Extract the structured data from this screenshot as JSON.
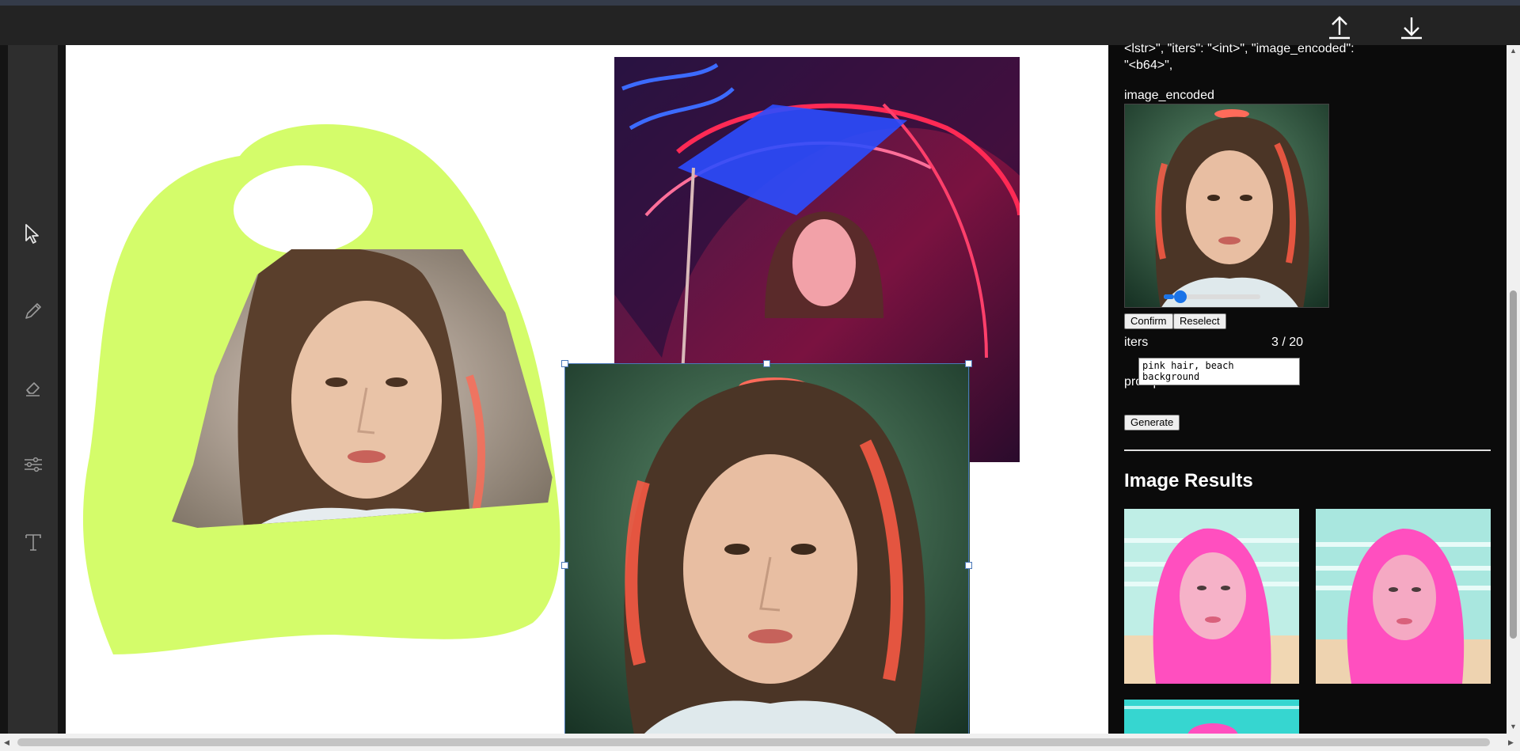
{
  "topbar": {
    "upload_icon": "upload-icon",
    "download_icon": "download-icon"
  },
  "tools": [
    "select-cursor-icon",
    "pencil-icon",
    "eraser-icon",
    "sliders-icon",
    "text-icon"
  ],
  "panel": {
    "schema_line1": "<lstr>\", \"iters\": \"<int>\", \"image_encoded\":",
    "schema_line2": "\"<b64>\",",
    "image_encoded_label": "image_encoded",
    "confirm_label": "Confirm",
    "reselect_label": "Reselect",
    "iters_label": "iters",
    "iters_value": 3,
    "iters_max": 20,
    "iters_display": "3 / 20",
    "prompt_label": "prompt",
    "prompt_value": "pink hair, beach background",
    "generate_label": "Generate",
    "results_title": "Image Results"
  },
  "colors": {
    "mask_green": "#d4fc6a",
    "accent_blue": "#1a73e8",
    "neon_red": "#ff2a55",
    "neon_blue": "#2b4cff",
    "pink_hair": "#ff4fbf",
    "beach_teal": "#9fe3dc"
  }
}
